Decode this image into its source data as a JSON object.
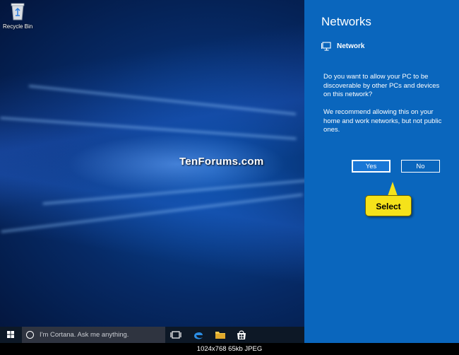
{
  "desktop": {
    "recycle_bin_label": "Recycle Bin",
    "watermark": "TenForums.com"
  },
  "panel": {
    "title": "Networks",
    "network_name": "Network",
    "question": "Do you want to allow your PC to be discoverable by other PCs and devices on this network?",
    "recommendation": "We recommend allowing this on your home and work networks, but not public ones.",
    "yes_label": "Yes",
    "no_label": "No",
    "callout_label": "Select",
    "background_color": "#0a66bd",
    "callout_color": "#f5e21a"
  },
  "taskbar": {
    "search_placeholder": "I'm Cortana. Ask me anything.",
    "icons": [
      "windows-start-icon",
      "cortana-icon",
      "task-view-icon",
      "edge-icon",
      "file-explorer-icon",
      "store-icon"
    ]
  },
  "image_info": "1024x768 65kb JPEG"
}
